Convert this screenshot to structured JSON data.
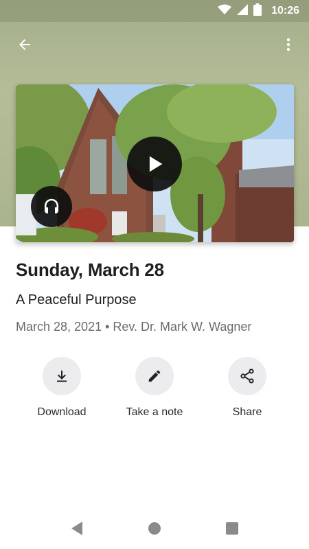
{
  "status_bar": {
    "time": "10:26",
    "icons": [
      "wifi-icon",
      "cellular-signal-icon",
      "battery-icon"
    ]
  },
  "app_bar": {
    "back_icon": "arrow-back-icon",
    "menu_icon": "more-vert-icon"
  },
  "media": {
    "play_icon": "play-icon",
    "audio_icon": "headphones-icon"
  },
  "sermon": {
    "title": "Sunday, March 28",
    "subtitle": "A Peaceful Purpose",
    "meta": "March 28, 2021 • Rev. Dr. Mark W. Wagner"
  },
  "actions": [
    {
      "label": "Download",
      "icon": "download-icon"
    },
    {
      "label": "Take a note",
      "icon": "pencil-icon"
    },
    {
      "label": "Share",
      "icon": "share-icon"
    }
  ],
  "nav": {
    "icons": [
      "nav-back-icon",
      "nav-home-icon",
      "nav-recents-icon"
    ]
  },
  "colors": {
    "header": "#b1ba94",
    "action_bg": "#ececee",
    "title": "#1f1f1f",
    "meta": "#6a6a6a"
  }
}
